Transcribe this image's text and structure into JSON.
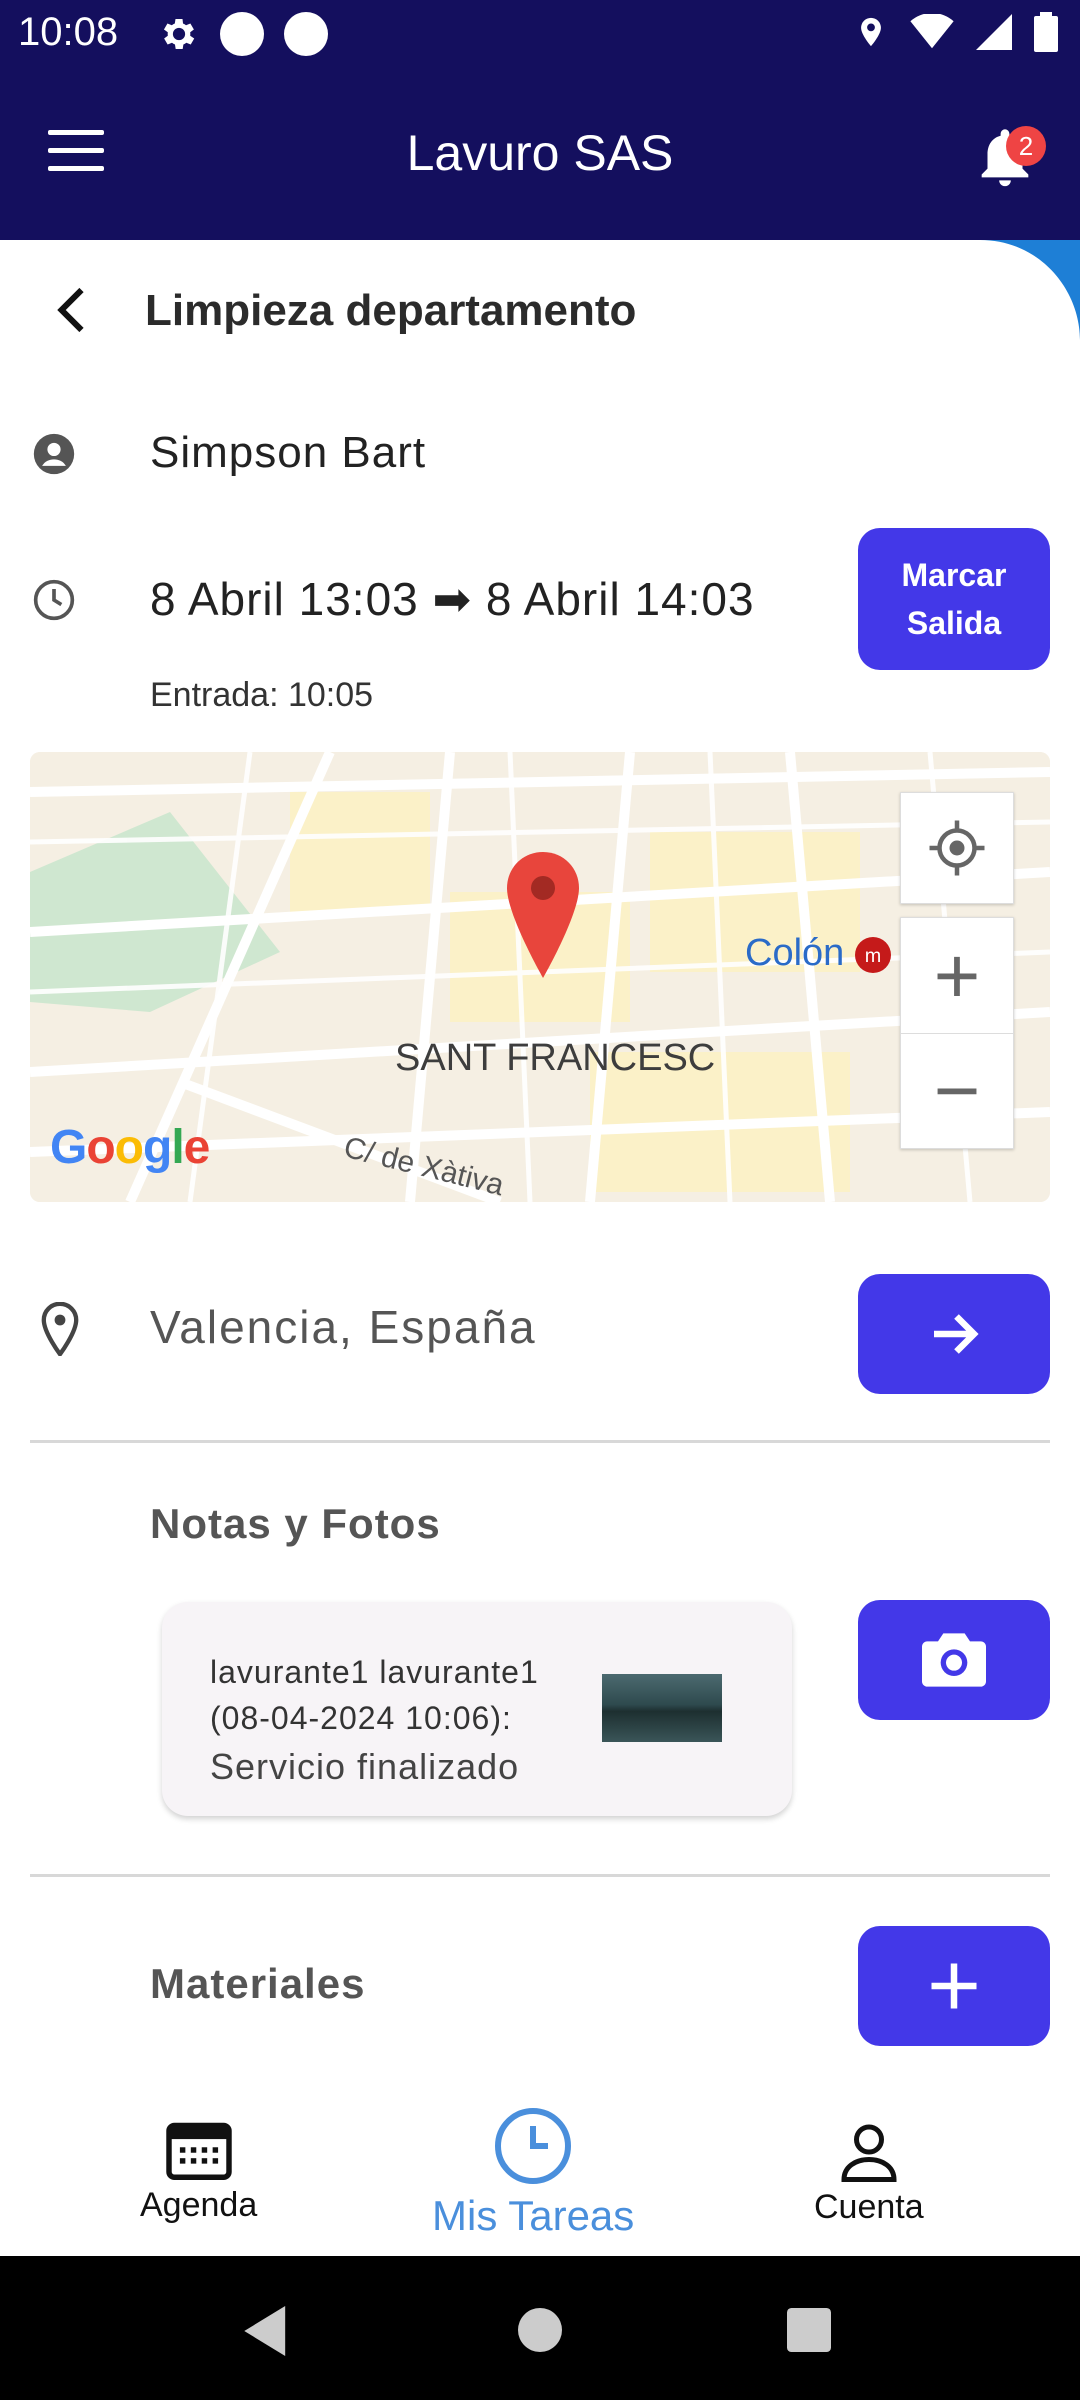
{
  "status_bar": {
    "time": "10:08"
  },
  "app_bar": {
    "title": "Lavuro SAS",
    "notification_count": "2"
  },
  "task": {
    "title": "Limpieza departamento",
    "client": "Simpson Bart",
    "time_range": "8 Abril 13:03 ➡ 8 Abril 14:03",
    "entrada": "Entrada: 10:05",
    "checkout_button": "Marcar Salida"
  },
  "map": {
    "labels": {
      "colon": "Colón",
      "district": "SANT FRANCESC",
      "street": "C/ de Xàtiva"
    },
    "logo": "Google",
    "zoom_in": "+",
    "zoom_out": "−"
  },
  "address": "Valencia,  España",
  "notes": {
    "section_title": "Notas y Fotos",
    "items": [
      {
        "author": "lavurante1 lavurante1",
        "date": "(08-04-2024 10:06):",
        "text": "Servicio finalizado"
      }
    ]
  },
  "materials": {
    "section_title": "Materiales"
  },
  "bottom_nav": {
    "items": [
      {
        "label": "Agenda",
        "icon": "calendar-icon"
      },
      {
        "label": "Mis Tareas",
        "icon": "clock-icon",
        "active": true
      },
      {
        "label": "Cuenta",
        "icon": "person-icon"
      }
    ]
  },
  "colors": {
    "primary": "#4338e8",
    "app_bar": "#140f5e",
    "active_nav": "#4a8fdc"
  }
}
